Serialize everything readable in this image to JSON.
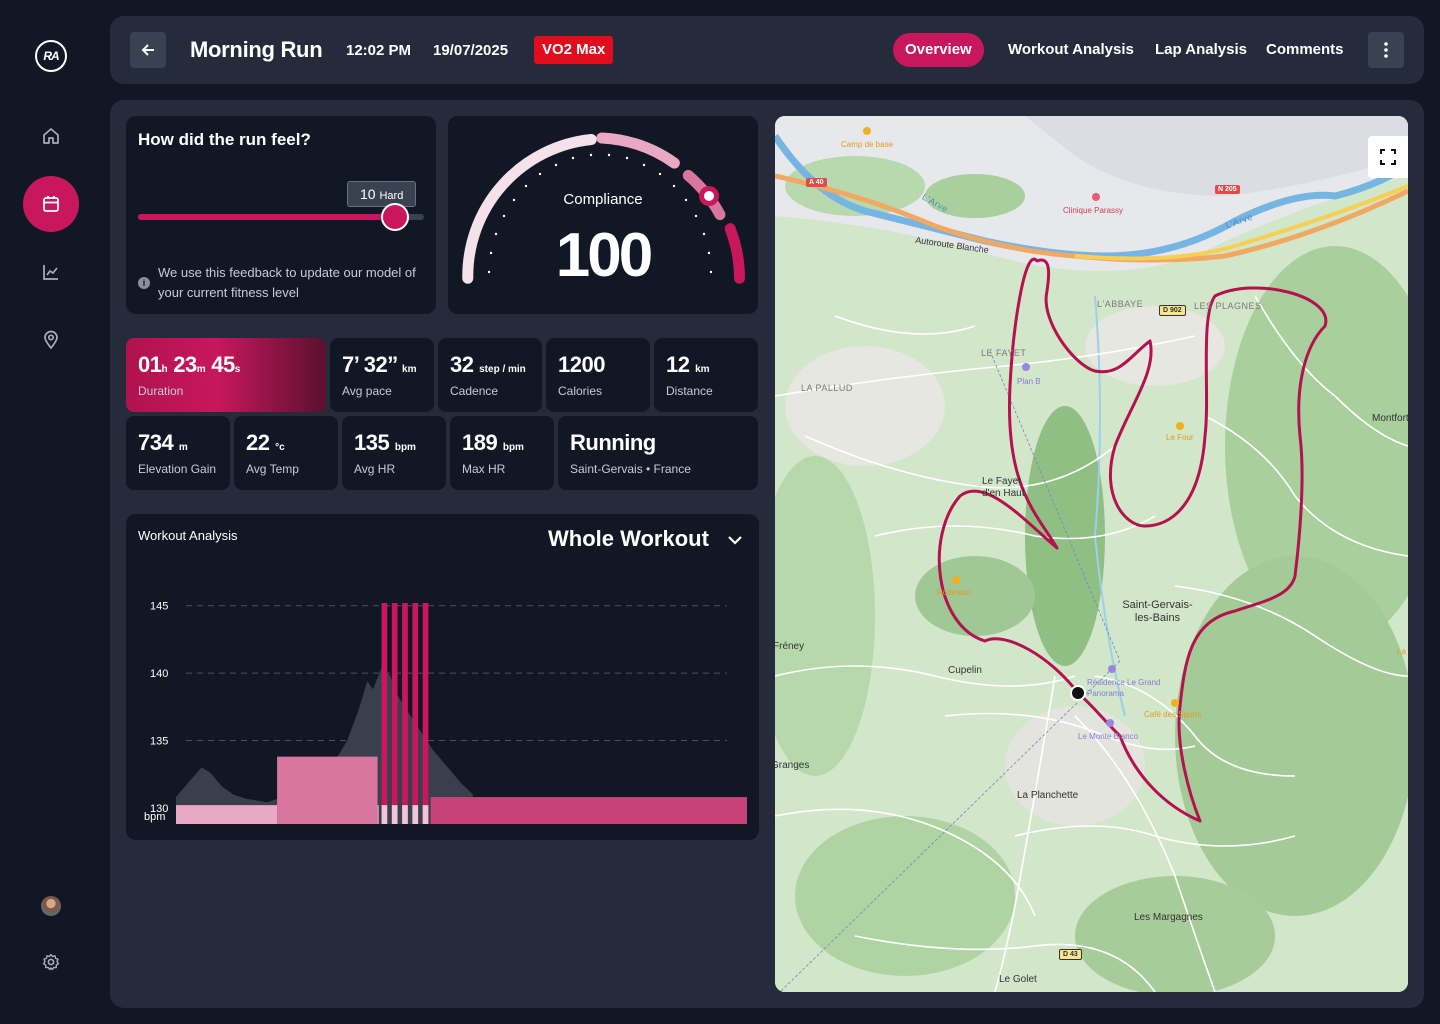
{
  "sidebar": {
    "logo": "RA",
    "items": [
      {
        "icon": "home-icon"
      },
      {
        "icon": "calendar-icon",
        "active": true
      },
      {
        "icon": "chart-icon"
      },
      {
        "icon": "location-icon"
      }
    ],
    "bottom": [
      {
        "icon": "avatar"
      },
      {
        "icon": "gear-icon"
      }
    ]
  },
  "header": {
    "title": "Morning Run",
    "time": "12:02 PM",
    "date": "19/07/2025",
    "badge": "VO2 Max",
    "tabs": [
      {
        "label": "Overview",
        "active": true
      },
      {
        "label": "Workout Analysis"
      },
      {
        "label": "Lap Analysis"
      },
      {
        "label": "Comments"
      }
    ]
  },
  "feel": {
    "title": "How did the run feel?",
    "value": "10",
    "value_label": "Hard",
    "level": 0.9,
    "info": "We use this feedback to update our model of your current fitness level"
  },
  "compliance": {
    "label": "Compliance",
    "value": "100"
  },
  "stats": [
    {
      "parts": [
        [
          "01",
          "h"
        ],
        [
          "23",
          "m"
        ],
        [
          "45",
          "s"
        ]
      ],
      "label": "Duration"
    },
    {
      "value": "7’ 32’’",
      "unit": "km",
      "label": "Avg pace"
    },
    {
      "value": "32",
      "unit": "step / min",
      "label": "Cadence"
    },
    {
      "value": "1200",
      "unit": "",
      "label": "Calories"
    },
    {
      "value": "12",
      "unit": "km",
      "label": "Distance"
    },
    {
      "value": "734",
      "unit": "m",
      "label": "Elevation Gain"
    },
    {
      "value": "22",
      "unit": "°c",
      "label": "Avg Temp"
    },
    {
      "value": "135",
      "unit": "bpm",
      "label": "Avg HR"
    },
    {
      "value": "189",
      "unit": "bpm",
      "label": "Max HR"
    },
    {
      "value": "Running",
      "unit": "",
      "label": "Saint-Gervais • France"
    }
  ],
  "workout": {
    "title": "Workout Analysis",
    "select": "Whole Workout"
  },
  "chart_data": {
    "type": "bar",
    "ylabel": "bpm",
    "yticks": [
      145,
      140,
      135,
      130
    ],
    "ylim": [
      128.8,
      147.5
    ],
    "grid": true,
    "bars": [
      {
        "start": 0,
        "end": 0.177,
        "value": 130.2,
        "color": "#e9a9c4"
      },
      {
        "start": 0.177,
        "end": 0.353,
        "value": 133.8,
        "color": "#d876a0"
      },
      {
        "start": 0.353,
        "end": 0.355,
        "value": 130.2,
        "color": "#e9a9c4"
      },
      {
        "start": 0.36,
        "end": 0.37,
        "value": 145.2,
        "color": "#c8175d"
      },
      {
        "start": 0.378,
        "end": 0.388,
        "value": 145.2,
        "color": "#c8175d"
      },
      {
        "start": 0.396,
        "end": 0.406,
        "value": 145.2,
        "color": "#c8175d"
      },
      {
        "start": 0.414,
        "end": 0.424,
        "value": 145.2,
        "color": "#c8175d"
      },
      {
        "start": 0.432,
        "end": 0.442,
        "value": 145.2,
        "color": "#c8175d"
      },
      {
        "start": 0.446,
        "end": 1.0,
        "value": 130.8,
        "color": "#c8427a"
      }
    ],
    "hr_trace": [
      [
        0,
        130.8
      ],
      [
        0.02,
        131.8
      ],
      [
        0.045,
        133.0
      ],
      [
        0.06,
        132.6
      ],
      [
        0.08,
        131.6
      ],
      [
        0.1,
        131.0
      ],
      [
        0.12,
        130.7
      ],
      [
        0.16,
        130.4
      ],
      [
        0.2,
        131.0
      ],
      [
        0.24,
        132.2
      ],
      [
        0.28,
        133.6
      ],
      [
        0.3,
        135.0
      ],
      [
        0.32,
        137.3
      ],
      [
        0.335,
        139.4
      ],
      [
        0.345,
        138.8
      ],
      [
        0.36,
        140.4
      ],
      [
        0.375,
        139.8
      ],
      [
        0.39,
        138.2
      ],
      [
        0.42,
        136.2
      ],
      [
        0.45,
        134.3
      ],
      [
        0.48,
        132.8
      ],
      [
        0.5,
        131.8
      ],
      [
        0.52,
        131.0
      ]
    ]
  },
  "map": {
    "labels": [
      "Camp de base",
      "A 40",
      "Clinique Parassy",
      "N 205",
      "L'Arve",
      "L'Arve",
      "Autoroute Blanche",
      "L'ABBAYE",
      "D 902",
      "LES PLAGNES",
      "LE FAYET",
      "Plan B",
      "LA PALLUD",
      "Le Four",
      "Montfort",
      "Le Fayet d'en Haut",
      "Robinson",
      "Saint-Gervais-les-Bains",
      "Fréney",
      "Cupelin",
      "Résidence Le Grand Panorama",
      "Café des Sports",
      "Le Monte Bianco",
      "Granges",
      "La Planchette",
      "Les Margagnes",
      "D 43",
      "Le Golet",
      "La T"
    ]
  }
}
